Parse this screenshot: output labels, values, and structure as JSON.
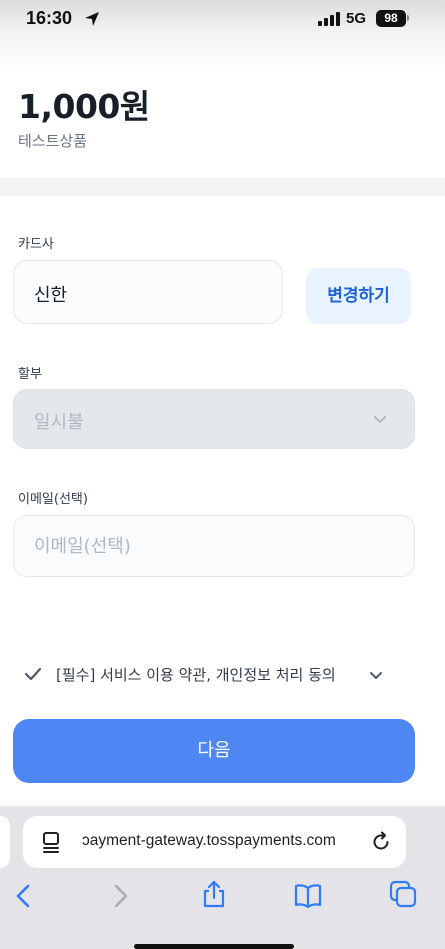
{
  "status": {
    "time": "16:30",
    "network": "5G",
    "battery": "98"
  },
  "order": {
    "amount": "1,000원",
    "product": "테스트상품"
  },
  "card": {
    "label": "카드사",
    "value": "신한",
    "change_label": "변경하기"
  },
  "installment": {
    "label": "할부",
    "value": "일시불"
  },
  "email": {
    "label": "이메일(선택)",
    "placeholder": "이메일(선택)",
    "value": ""
  },
  "agreement": {
    "text": "[필수] 서비스 이용 약관, 개인정보 처리 동의"
  },
  "next_label": "다음",
  "browser": {
    "url": "ɔayment-gateway.tosspayments.com"
  },
  "icons": {
    "location": "location-arrow-icon",
    "signal": "cellular-signal-icon",
    "battery": "battery-icon",
    "select": "chevron-down-icon",
    "check": "checkmark-icon",
    "reader": "reader-mode-icon",
    "reload": "reload-icon",
    "back": "back-chevron-icon",
    "forward": "forward-chevron-icon",
    "share": "share-icon",
    "bookmarks": "bookmarks-icon",
    "tabs": "tabs-icon"
  },
  "colors": {
    "primary": "#4e87f4",
    "change_text": "#1b64da",
    "change_bg": "#e8f3ff",
    "safari_blue": "#2f7cf6"
  }
}
